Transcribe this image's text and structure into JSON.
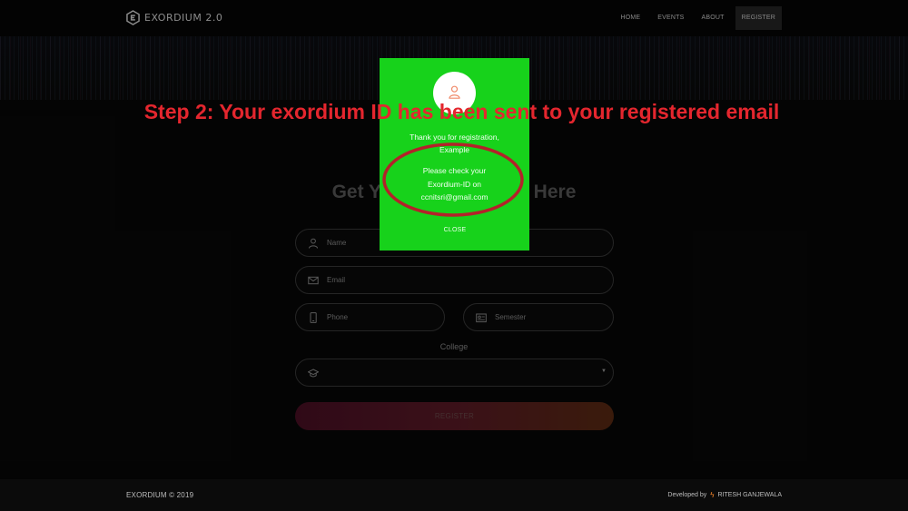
{
  "nav": {
    "brand": "EXORDIUM 2.0",
    "links": [
      "HOME",
      "EVENTS",
      "ABOUT",
      "REGISTER"
    ],
    "active_link": "REGISTER"
  },
  "form": {
    "title": "Get Your Exordium ID Here",
    "name_placeholder": "Name",
    "email_placeholder": "Email",
    "phone_placeholder": "Phone",
    "semester_placeholder": "Semester",
    "college_label": "College",
    "register_label": "REGISTER"
  },
  "modal": {
    "thanks_line1": "Thank you for registration,",
    "thanks_line2": "Example",
    "check_line1": "Please check your",
    "check_line2": "Exordium-ID on",
    "check_line3": "ccnitsri@gmail.com",
    "close_label": "CLOSE"
  },
  "annotation": {
    "step_text": "Step 2: Your exordium ID has been sent to your registered email"
  },
  "footer": {
    "copyright": "EXORDIUM © 2019",
    "developed_by": "Developed by",
    "developer": "RITESH GANJEWALA"
  },
  "colors": {
    "modal_bg": "#17d21b",
    "annotation_red": "#e4262e",
    "page_bg": "#070707"
  },
  "icons": [
    "logo-icon",
    "user-icon",
    "mail-icon",
    "phone-icon",
    "id-card-icon",
    "graduation-cap-icon",
    "chevron-down-icon",
    "bolt-icon"
  ]
}
